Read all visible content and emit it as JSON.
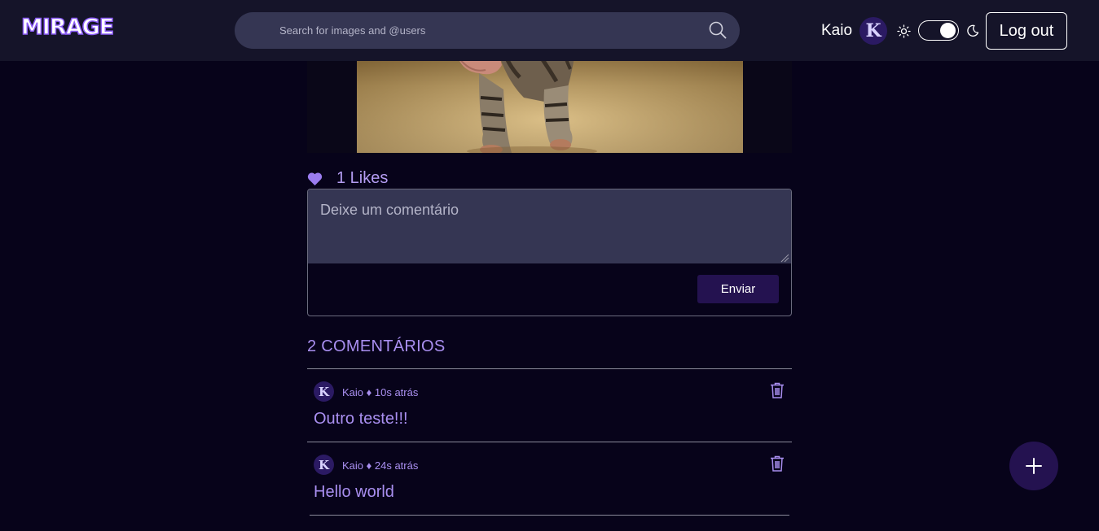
{
  "header": {
    "logo_text": "MIRAGE",
    "search": {
      "placeholder": "Search for images and @users",
      "value": ""
    },
    "user": {
      "name": "Kaio",
      "avatar_letter": "K"
    },
    "theme_toggle": {
      "mode": "dark"
    },
    "logout_label": "Log out"
  },
  "post": {
    "image_alt": "cat",
    "likes": {
      "count_label": "1 Likes"
    },
    "comment_form": {
      "placeholder": "Deixe um comentário",
      "value": "",
      "send_label": "Enviar"
    },
    "comments_title": "2 COMENTÁRIOS",
    "comments": [
      {
        "avatar_letter": "K",
        "meta": "Kaio ♦ 10s atrás",
        "text": "Outro teste!!!"
      },
      {
        "avatar_letter": "K",
        "meta": "Kaio ♦ 24s atrás",
        "text": "Hello world"
      }
    ]
  },
  "colors": {
    "background": "#07031a",
    "header": "#151429",
    "accent": "#a98ff0",
    "button": "#241250"
  }
}
